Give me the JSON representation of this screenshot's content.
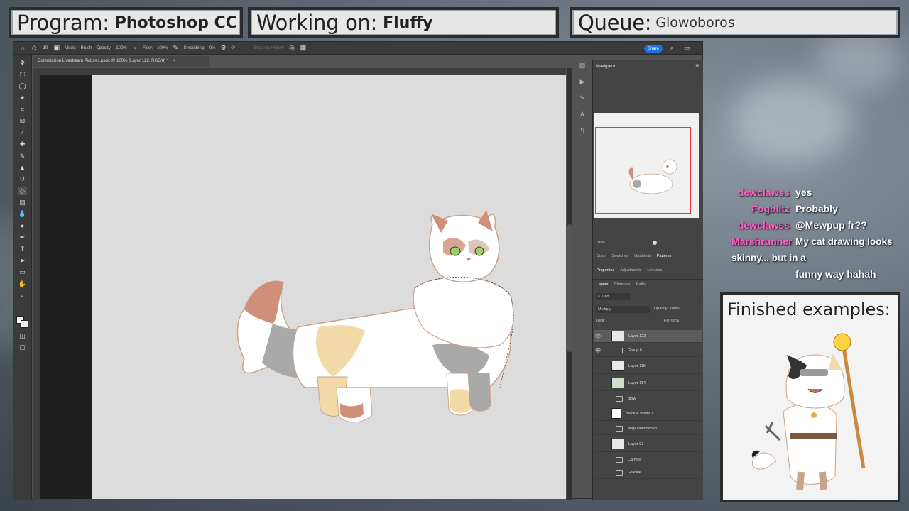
{
  "overlay": {
    "program_label": "Program:",
    "program_value": "Photoshop CC",
    "working_label": "Working on:",
    "working_value": "Fluffy",
    "queue_label": "Queue:",
    "queue_value": "Glowoboros",
    "finished_title": "Finished examples:"
  },
  "options_bar": {
    "mode_label": "Mode:",
    "mode_value": "Brush",
    "opacity_label": "Opacity:",
    "opacity_value": "100%",
    "flow_label": "Flow:",
    "flow_value": "100%",
    "smoothing_label": "Smoothing:",
    "smoothing_value": "0%",
    "erase_history": "Erase to History",
    "angle_value": "0°",
    "share_label": "Share",
    "brush_size": "10"
  },
  "document": {
    "tab_title": "Commission Livestream Pictures.psdc @ 100% (Layer 122, RGB/8) *"
  },
  "panels": {
    "navigator_title": "Navigator",
    "zoom_value": "100%",
    "swatch_tabs": [
      "Color",
      "Swatches",
      "Gradients",
      "Patterns"
    ],
    "prop_tabs": [
      "Properties",
      "Adjustments",
      "Libraries"
    ],
    "layer_tabs": [
      "Layers",
      "Channels",
      "Paths"
    ],
    "kind_label": "Kind",
    "blend_mode": "Multiply",
    "opacity_label": "Opacity:",
    "opacity_value": "100%",
    "lock_label": "Lock:",
    "fill_label": "Fill:",
    "fill_value": "68%",
    "layers": [
      {
        "name": "Layer 122"
      },
      {
        "name": "Group 6"
      },
      {
        "name": "Layer 115"
      },
      {
        "name": "Layer 114"
      },
      {
        "name": "glow"
      },
      {
        "name": "Black & White 1"
      },
      {
        "name": "aerpulatecryman"
      },
      {
        "name": "Layer 93"
      },
      {
        "name": "Carmol"
      },
      {
        "name": "Grackle"
      }
    ]
  },
  "chat": [
    {
      "user": "dewclawss",
      "message": "yes"
    },
    {
      "user": "Fogblitz",
      "message": "Probably"
    },
    {
      "user": "dewclawss",
      "message": "@Mewpup fr??"
    },
    {
      "user": "Marshrunner",
      "message": "My cat drawing looks skinny... but in a"
    },
    {
      "user": "",
      "message": "funny way hahah"
    }
  ],
  "colors": {
    "chat_username": "#ff5ec6",
    "share_button": "#1f73e0",
    "navigator_frame": "#ee3333"
  }
}
